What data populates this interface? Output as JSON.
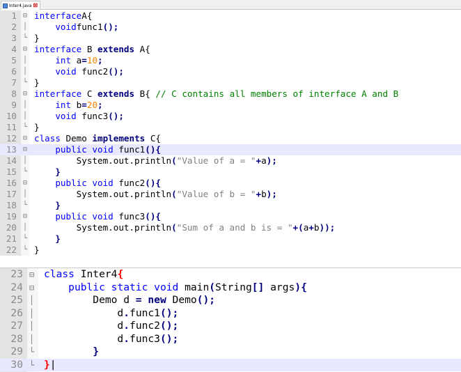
{
  "tab": {
    "title": "Inter4.java",
    "close": "⊠",
    "save_icon": "save-icon"
  },
  "pane1": {
    "lines": [
      {
        "n": "1",
        "fold": "⊟",
        "t": [
          [
            "kw",
            "interface"
          ],
          [
            "",
            "A{"
          ]
        ]
      },
      {
        "n": "2",
        "fold": "│",
        "t": [
          [
            "",
            "    "
          ],
          [
            "kw",
            "void"
          ],
          [
            "",
            "func1"
          ],
          [
            "op",
            "();"
          ]
        ]
      },
      {
        "n": "3",
        "fold": "└",
        "t": [
          [
            "",
            "}"
          ]
        ]
      },
      {
        "n": "4",
        "fold": "⊟",
        "t": [
          [
            "kw",
            "interface"
          ],
          [
            "",
            " B "
          ],
          [
            "kwb",
            "extends"
          ],
          [
            "",
            " A{"
          ]
        ]
      },
      {
        "n": "5",
        "fold": "│",
        "t": [
          [
            "",
            "    "
          ],
          [
            "kw",
            "int"
          ],
          [
            "",
            " a"
          ],
          [
            "op",
            "="
          ],
          [
            "num",
            "10"
          ],
          [
            "op",
            ";"
          ]
        ]
      },
      {
        "n": "6",
        "fold": "│",
        "t": [
          [
            "",
            "    "
          ],
          [
            "kw",
            "void"
          ],
          [
            "",
            " func2"
          ],
          [
            "op",
            "();"
          ]
        ]
      },
      {
        "n": "7",
        "fold": "└",
        "t": [
          [
            "",
            "}"
          ]
        ]
      },
      {
        "n": "8",
        "fold": "⊟",
        "t": [
          [
            "kw",
            "interface"
          ],
          [
            "",
            " C "
          ],
          [
            "kwb",
            "extends"
          ],
          [
            "",
            " B{ "
          ],
          [
            "cmt",
            "// C contains all members of interface A and B"
          ]
        ]
      },
      {
        "n": "9",
        "fold": "│",
        "t": [
          [
            "",
            "    "
          ],
          [
            "kw",
            "int"
          ],
          [
            "",
            " b"
          ],
          [
            "op",
            "="
          ],
          [
            "num",
            "20"
          ],
          [
            "op",
            ";"
          ]
        ]
      },
      {
        "n": "10",
        "fold": "│",
        "t": [
          [
            "",
            "    "
          ],
          [
            "kw",
            "void"
          ],
          [
            "",
            " func3"
          ],
          [
            "op",
            "();"
          ]
        ]
      },
      {
        "n": "11",
        "fold": "└",
        "t": [
          [
            "",
            "}"
          ]
        ]
      },
      {
        "n": "12",
        "fold": "⊟",
        "t": [
          [
            "kw",
            "class"
          ],
          [
            "",
            " Demo "
          ],
          [
            "kwb",
            "implements"
          ],
          [
            "",
            " C{"
          ]
        ]
      },
      {
        "n": "13",
        "fold": "⊟",
        "active": true,
        "t": [
          [
            "",
            "    "
          ],
          [
            "kw",
            "public void"
          ],
          [
            "",
            " func1"
          ],
          [
            "op",
            "(){"
          ]
        ]
      },
      {
        "n": "14",
        "fold": "│",
        "t": [
          [
            "",
            "        System.out.println"
          ],
          [
            "op",
            "("
          ],
          [
            "str",
            "\"Value of a = \""
          ],
          [
            "op",
            "+"
          ],
          [
            "",
            "a"
          ],
          [
            "op",
            ");"
          ]
        ]
      },
      {
        "n": "15",
        "fold": "└",
        "t": [
          [
            "",
            "    "
          ],
          [
            "op",
            "}"
          ]
        ]
      },
      {
        "n": "16",
        "fold": "⊟",
        "t": [
          [
            "",
            "    "
          ],
          [
            "kw",
            "public void"
          ],
          [
            "",
            " func2"
          ],
          [
            "op",
            "(){"
          ]
        ]
      },
      {
        "n": "17",
        "fold": "│",
        "t": [
          [
            "",
            "        System.out.println"
          ],
          [
            "op",
            "("
          ],
          [
            "str",
            "\"Value of b = \""
          ],
          [
            "op",
            "+"
          ],
          [
            "",
            "b"
          ],
          [
            "op",
            ");"
          ]
        ]
      },
      {
        "n": "18",
        "fold": "└",
        "t": [
          [
            "",
            "    "
          ],
          [
            "op",
            "}"
          ]
        ]
      },
      {
        "n": "19",
        "fold": "⊟",
        "t": [
          [
            "",
            "    "
          ],
          [
            "kw",
            "public void"
          ],
          [
            "",
            " func3"
          ],
          [
            "op",
            "(){"
          ]
        ]
      },
      {
        "n": "20",
        "fold": "│",
        "t": [
          [
            "",
            "        System.out.println"
          ],
          [
            "op",
            "("
          ],
          [
            "str",
            "\"Sum of a and b is = \""
          ],
          [
            "op",
            "+("
          ],
          [
            "",
            "a"
          ],
          [
            "op",
            "+"
          ],
          [
            "",
            "b"
          ],
          [
            "op",
            "));"
          ]
        ]
      },
      {
        "n": "21",
        "fold": "└",
        "t": [
          [
            "",
            "    "
          ],
          [
            "op",
            "}"
          ]
        ]
      },
      {
        "n": "22",
        "fold": "└",
        "t": [
          [
            "",
            "}"
          ]
        ]
      }
    ]
  },
  "pane2": {
    "lines": [
      {
        "n": "23",
        "fold": "⊟",
        "t": [
          [
            "kw",
            "class"
          ],
          [
            "",
            " Inter4"
          ],
          [
            "brm",
            "{"
          ]
        ]
      },
      {
        "n": "24",
        "fold": "⊟",
        "t": [
          [
            "",
            "    "
          ],
          [
            "kw",
            "public static void"
          ],
          [
            "",
            " main"
          ],
          [
            "op",
            "("
          ],
          [
            "",
            "String"
          ],
          [
            "op",
            "[]"
          ],
          [
            "",
            " args"
          ],
          [
            "op",
            "){"
          ]
        ]
      },
      {
        "n": "25",
        "fold": "│",
        "t": [
          [
            "",
            "        Demo d "
          ],
          [
            "op",
            "="
          ],
          [
            "",
            " "
          ],
          [
            "kwb",
            "new"
          ],
          [
            "",
            " Demo"
          ],
          [
            "op",
            "();"
          ]
        ]
      },
      {
        "n": "26",
        "fold": "│",
        "t": [
          [
            "",
            "            d"
          ],
          [
            "op",
            "."
          ],
          [
            "",
            "func1"
          ],
          [
            "op",
            "();"
          ]
        ]
      },
      {
        "n": "27",
        "fold": "│",
        "t": [
          [
            "",
            "            d"
          ],
          [
            "op",
            "."
          ],
          [
            "",
            "func2"
          ],
          [
            "op",
            "();"
          ]
        ]
      },
      {
        "n": "28",
        "fold": "│",
        "t": [
          [
            "",
            "            d"
          ],
          [
            "op",
            "."
          ],
          [
            "",
            "func3"
          ],
          [
            "op",
            "();"
          ]
        ]
      },
      {
        "n": "29",
        "fold": "└",
        "t": [
          [
            "",
            "        "
          ],
          [
            "op",
            "}"
          ]
        ]
      },
      {
        "n": "30",
        "fold": "└",
        "active": true,
        "t": [
          [
            "brm",
            "}"
          ],
          [
            "",
            "|"
          ]
        ]
      }
    ]
  }
}
